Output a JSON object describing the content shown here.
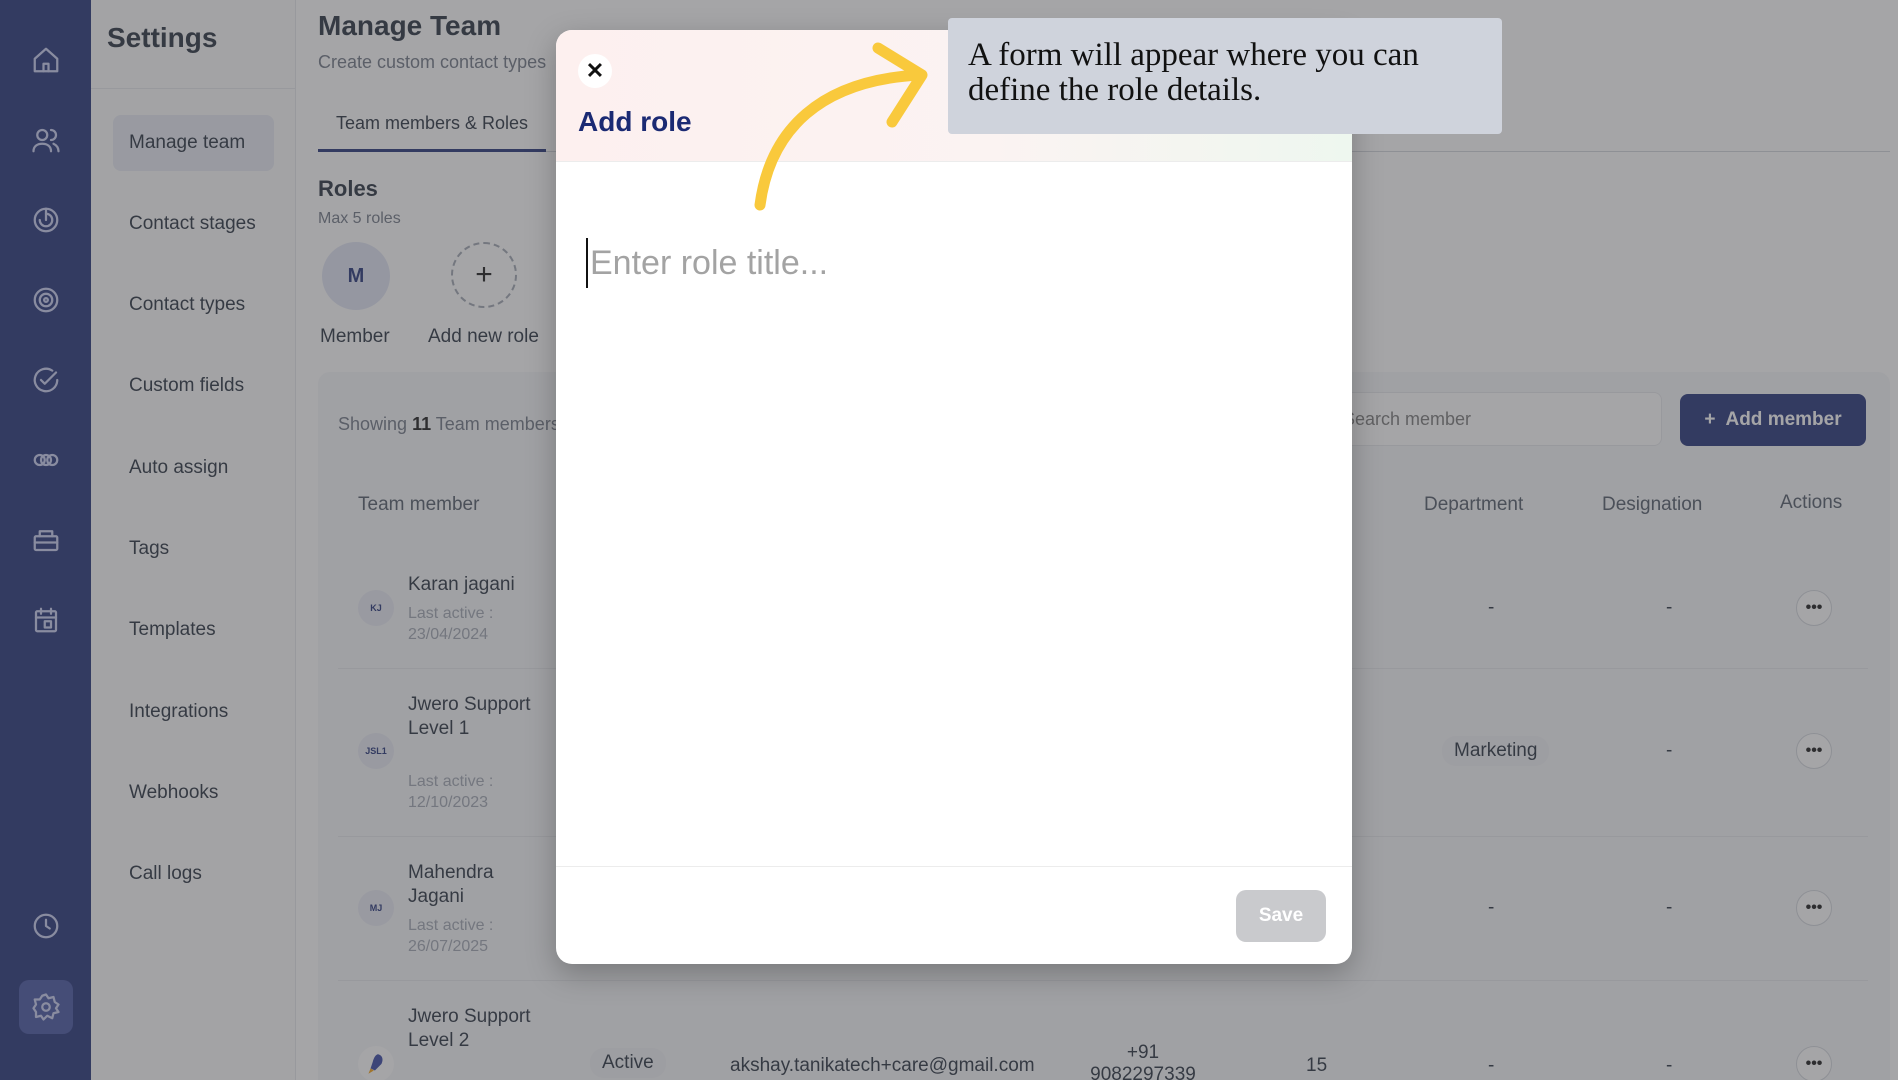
{
  "rail": {
    "icons": [
      "home-icon",
      "contacts-icon",
      "pipeline-icon",
      "target-icon",
      "tasks-icon",
      "automation-icon",
      "inbox-icon",
      "calendar-icon",
      "history-icon",
      "settings-icon"
    ]
  },
  "sidebar": {
    "title": "Settings",
    "items": [
      {
        "label": "Manage team",
        "active": true
      },
      {
        "label": "Contact stages"
      },
      {
        "label": "Contact types"
      },
      {
        "label": "Custom fields"
      },
      {
        "label": "Auto assign"
      },
      {
        "label": "Tags"
      },
      {
        "label": "Templates"
      },
      {
        "label": "Integrations"
      },
      {
        "label": "Webhooks"
      },
      {
        "label": "Call logs"
      }
    ]
  },
  "main": {
    "title": "Manage Team",
    "subtitle": "Create custom contact types",
    "tab": "Team members & Roles",
    "roles": {
      "heading": "Roles",
      "sub": "Max 5 roles",
      "items": [
        {
          "initial": "M",
          "label": "Member"
        },
        {
          "initial": "+",
          "label": "Add new role"
        }
      ]
    },
    "showing_prefix": "Showing",
    "showing_count": "11",
    "showing_suffix": "Team members",
    "search_placeholder": "Search member",
    "add_member": "Add member",
    "columns": {
      "member": "Team member",
      "department": "Department",
      "designation": "Designation",
      "actions": "Actions"
    },
    "rows": [
      {
        "initials": "KJ",
        "name": "Karan jagani",
        "last_active": "Last active : 23/04/2024",
        "department": "-",
        "designation": "-"
      },
      {
        "initials": "JSL1",
        "name": "Jwero Support Level 1",
        "last_active": "Last active : 12/10/2023",
        "department": "Marketing",
        "designation": "-"
      },
      {
        "initials": "MJ",
        "name": "Mahendra Jagani",
        "last_active": "Last active : 26/07/2025",
        "department": "-",
        "designation": "-"
      },
      {
        "initials": "",
        "name": "Jwero Support Level 2",
        "status": "Active",
        "email": "akshay.tanikatech+care@gmail.com",
        "phone": "+91 9082297339",
        "count": "15",
        "department": "-",
        "designation": "-"
      }
    ],
    "actions_glyph": "•••"
  },
  "modal": {
    "close_glyph": "✕",
    "title": "Add role",
    "input_placeholder": "Enter role title...",
    "save": "Save"
  },
  "callout": {
    "text": "A form will appear where you can define the role details."
  },
  "colors": {
    "rail": "#1b2a73",
    "accent": "#1b2a73",
    "arrow": "#f9c93c",
    "callout_bg": "#cfd3dc"
  }
}
